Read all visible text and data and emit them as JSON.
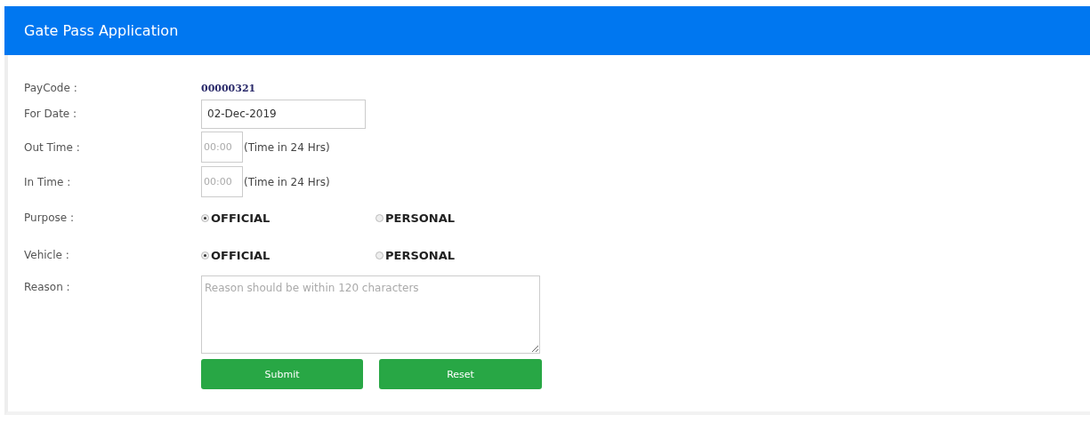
{
  "header": {
    "title": "Gate Pass Application"
  },
  "paycode": {
    "label": "PayCode :",
    "value": "00000321"
  },
  "for_date": {
    "label": "For Date :",
    "value": "02-Dec-2019"
  },
  "out_time": {
    "label": "Out Time :",
    "placeholder": "00:00",
    "hint": "(Time in 24 Hrs)"
  },
  "in_time": {
    "label": "In Time :",
    "placeholder": "00:00",
    "hint": "(Time in 24 Hrs)"
  },
  "purpose": {
    "label": "Purpose :",
    "options": [
      {
        "label": "OFFICIAL",
        "selected": true
      },
      {
        "label": "PERSONAL",
        "selected": false
      }
    ]
  },
  "vehicle": {
    "label": "Vehicle :",
    "options": [
      {
        "label": "OFFICIAL",
        "selected": true
      },
      {
        "label": "PERSONAL",
        "selected": false
      }
    ]
  },
  "reason": {
    "label": "Reason :",
    "placeholder": "Reason should be within 120 characters"
  },
  "buttons": [
    {
      "label": "Submit"
    },
    {
      "label": "Reset"
    }
  ]
}
